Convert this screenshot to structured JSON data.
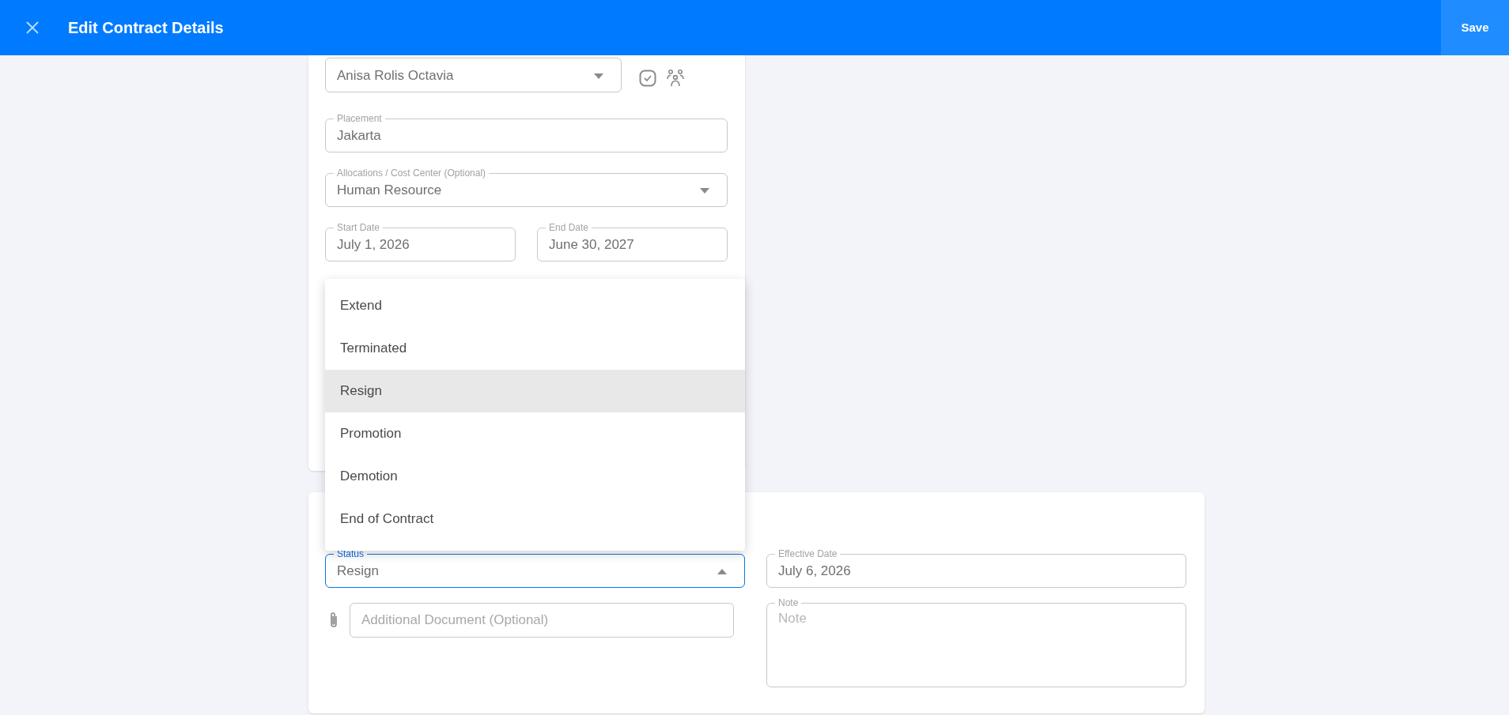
{
  "header": {
    "title": "Edit Contract Details",
    "save_button": "Save"
  },
  "employment_card": {
    "fields": [
      {
        "kind": "select",
        "value": "Anisa Rolis Octavia"
      },
      {
        "kind": "text",
        "label": "Placement",
        "value": "Jakarta"
      },
      {
        "kind": "select",
        "label": "Allocations / Cost Center (Optional)",
        "value": "Human Resource"
      },
      {
        "kind": "date_pair",
        "start": {
          "label": "Start Date",
          "value": "July 1, 2026"
        },
        "end": {
          "label": "End Date",
          "value": "June 30, 2027"
        }
      }
    ]
  },
  "status_dropdown": {
    "options": [
      {
        "label": "Extend",
        "selected": false
      },
      {
        "label": "Terminated",
        "selected": false
      },
      {
        "label": "Resign",
        "selected": true
      },
      {
        "label": "Promotion",
        "selected": false
      },
      {
        "label": "Demotion",
        "selected": false
      },
      {
        "label": "End of Contract",
        "selected": false
      }
    ]
  },
  "status_card": {
    "status": {
      "label": "Status",
      "value": "Resign",
      "focused": true,
      "expanded": true
    },
    "effective_date": {
      "label": "Effective Date",
      "value": "July 6, 2026"
    },
    "document": {
      "placeholder": "Additional Document (Optional)"
    },
    "note": {
      "label": "Note",
      "placeholder": "Note"
    }
  }
}
